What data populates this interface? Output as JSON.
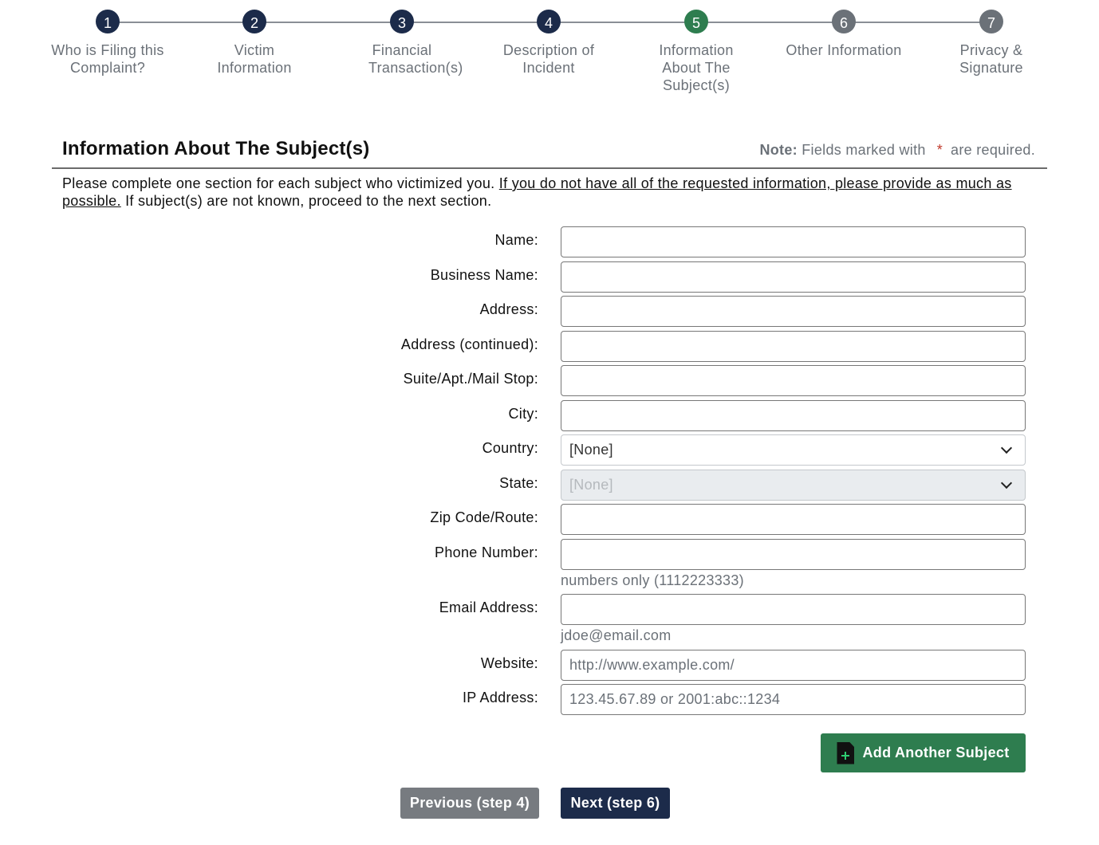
{
  "colors": {
    "step_done": "#1c2b4a",
    "step_current": "#2e7d4f",
    "step_future": "#6b7178",
    "required_star": "#c0392b",
    "add_button": "#2e7d4f",
    "prev_button": "#777b80",
    "next_button": "#1c2b4a"
  },
  "stepper": {
    "steps": [
      {
        "number": "1",
        "label": "Who is Filing this Complaint?",
        "state": "done"
      },
      {
        "number": "2",
        "label": "Victim Information",
        "state": "done"
      },
      {
        "number": "3",
        "label": "Financial Transaction(s)",
        "state": "done"
      },
      {
        "number": "4",
        "label": "Description of Incident",
        "state": "done"
      },
      {
        "number": "5",
        "label": "Information About The Subject(s)",
        "state": "current"
      },
      {
        "number": "6",
        "label": "Other Information",
        "state": "future"
      },
      {
        "number": "7",
        "label": "Privacy & Signature",
        "state": "future"
      }
    ]
  },
  "header": {
    "title": "Information About The Subject(s)",
    "note_bold": "Note:",
    "note_text": "Fields marked with",
    "note_star": "*",
    "note_end": "are required."
  },
  "intro": {
    "text_1": "Please complete one section for each subject who victimized you.",
    "underlined": "If you do not have all of the requested information, please provide as much as possible.",
    "text_2": "If subject(s) are not known, proceed to the next section."
  },
  "form": {
    "name_label": "Name:",
    "business_label": "Business Name:",
    "address_label": "Address:",
    "address2_label": "Address (continued):",
    "suite_label": "Suite/Apt./Mail Stop:",
    "city_label": "City:",
    "country_label": "Country:",
    "country_value": "[None]",
    "state_label": "State:",
    "state_value": "[None]",
    "zip_label": "Zip Code/Route:",
    "phone_label": "Phone Number:",
    "phone_hint": "numbers only (1112223333)",
    "email_label": "Email Address:",
    "email_hint": "jdoe@email.com",
    "website_label": "Website:",
    "website_placeholder": "http://www.example.com/",
    "ip_label": "IP Address:",
    "ip_placeholder": "123.45.67.89 or 2001:abc::1234"
  },
  "buttons": {
    "add_subject": "Add Another Subject",
    "previous": "Previous (step 4)",
    "next": "Next (step 6)"
  }
}
